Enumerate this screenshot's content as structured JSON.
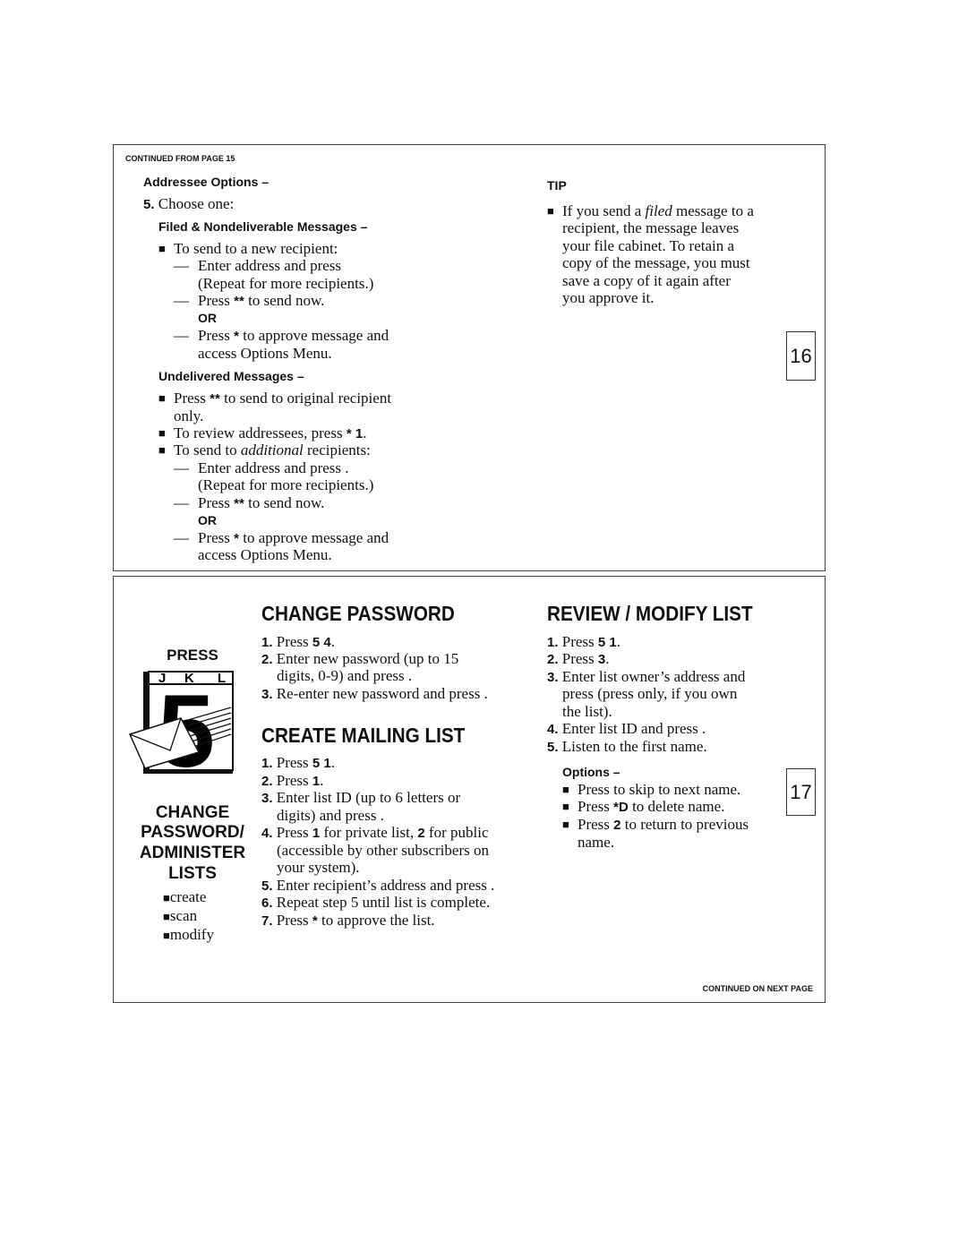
{
  "top": {
    "continued_from": "CONTINUED FROM PAGE 15",
    "addressee_heading": "Addressee Options –",
    "step5_num": "5.",
    "step5_text": "Choose one:",
    "filed_heading": "Filed & Nondeliverable Messages –",
    "f1": "To send to a new recipient:",
    "f2": "Enter address and press",
    "f3": "(Repeat for more recipients.)",
    "press": "Press",
    "key_dstar": "**",
    "key_star": "*",
    "send_now": "to send now.",
    "or": "OR",
    "approve": "to approve message and",
    "access": "access Options Menu.",
    "undelivered_heading": "Undelivered Messages –",
    "u1": "to send to original recipient",
    "u1b": "only.",
    "u2a": "To review addressees, press",
    "u2key": "* 1",
    "u3a": "To send to ",
    "u3i": "additional",
    "u3b": " recipients:",
    "u4": "Enter address and press  .",
    "dash": "—",
    "bullet": "■",
    "period": "."
  },
  "tip": {
    "heading": "TIP",
    "l1a": "If you send a ",
    "l1i": "filed",
    "l1b": " message to a",
    "l2": "recipient, the message leaves",
    "l3": "your file cabinet.  To retain a",
    "l4": "copy of the message, you must",
    "l5": "save a copy of it again after",
    "l6": "you approve it."
  },
  "page_numbers": [
    "16",
    "17"
  ],
  "side": {
    "press": "PRESS",
    "keys": [
      "J",
      "K",
      "L"
    ],
    "digit": "5",
    "title": [
      "CHANGE",
      "PASSWORD/",
      "ADMINISTER",
      "LISTS"
    ],
    "items": [
      "create",
      "scan",
      "modify"
    ]
  },
  "change_password": {
    "title": "CHANGE PASSWORD",
    "s1": "Press ",
    "s1k": "5 4",
    "s2a": "Enter new password (up to 15",
    "s2b": "digits, 0-9) and press .",
    "s3": "Re-enter new password and press ."
  },
  "create_list": {
    "title": "CREATE MAILING LIST",
    "s1k": "5 1",
    "s2k": "1",
    "s3a": "Enter list ID (up to 6 letters or",
    "s3b": "digits) and press .",
    "s4a": "for private list, ",
    "s4k1": "1",
    "s4k2": "2",
    "s4b": " for public",
    "s4c": "(accessible by other subscribers on",
    "s4d": "your system).",
    "s5": "Enter recipient’s address and press .",
    "s6": "Repeat step 5 until list is complete.",
    "s7": "to approve the list."
  },
  "review_list": {
    "title": "REVIEW / MODIFY LIST",
    "s1k": "5 1",
    "s2k": "3",
    "s3a": "Enter list owner’s address and",
    "s3b": "press (press only, if you own",
    "s3c": "the list).",
    "s4": "Enter list ID and press .",
    "s5": "Listen to the first name.",
    "options_heading": "Options –",
    "o1": "Press to skip to next name.",
    "o2k": "*D",
    "o2": " to delete name.",
    "o3k": "2",
    "o3": " to return to previous",
    "o3b": "name."
  },
  "continued_on": "CONTINUED ON NEXT PAGE"
}
